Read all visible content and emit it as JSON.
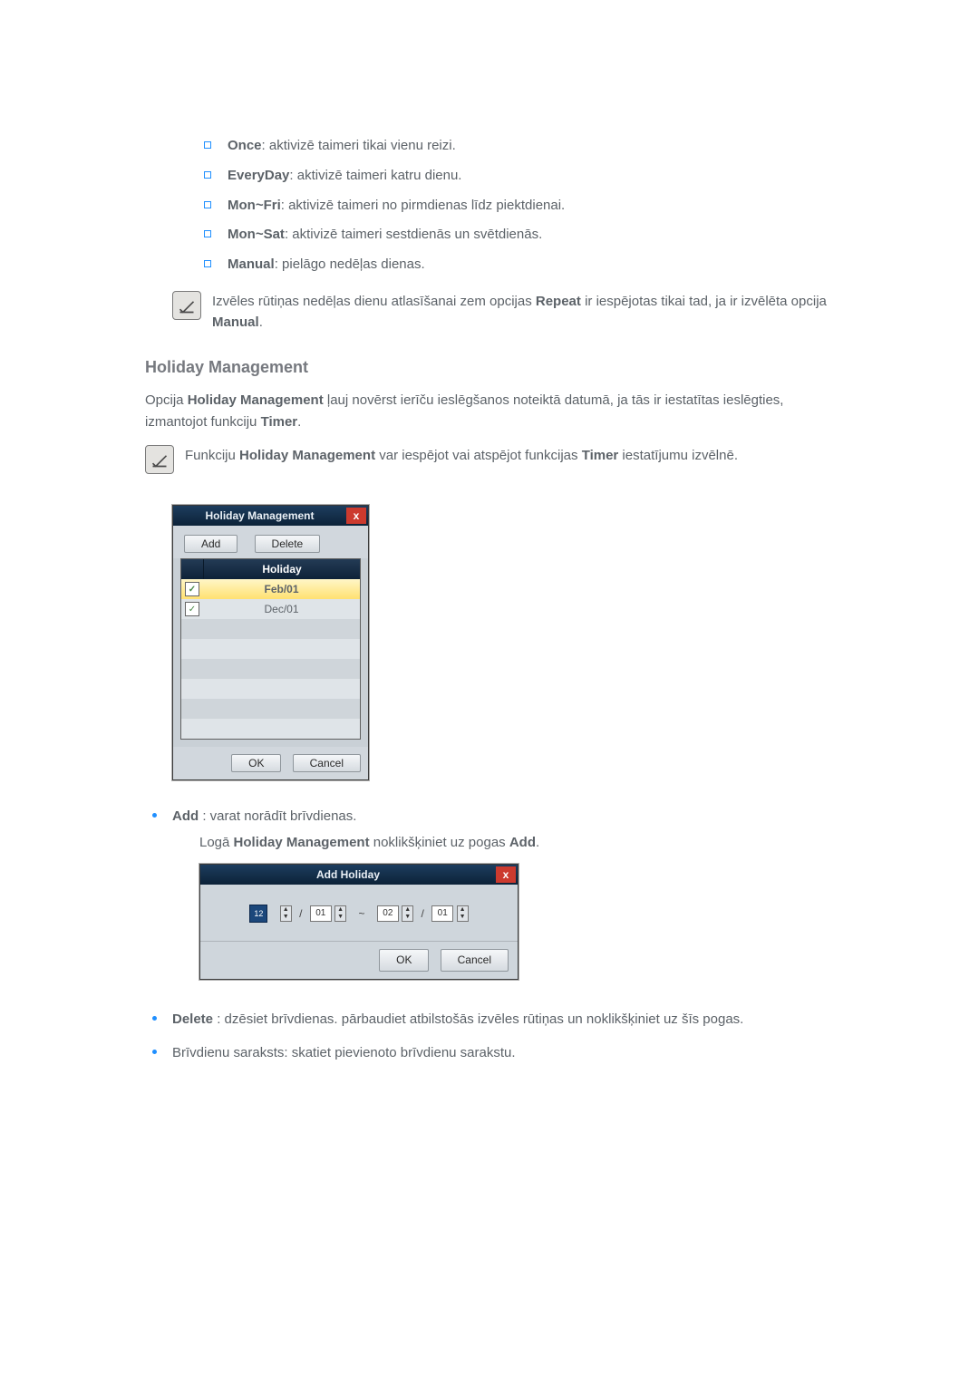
{
  "sublist": [
    {
      "label": "Once",
      "desc": ": aktivizē taimeri tikai vienu reizi."
    },
    {
      "label": "EveryDay",
      "desc": ": aktivizē taimeri katru dienu."
    },
    {
      "label": "Mon~Fri",
      "desc": ": aktivizē taimeri no pirmdienas līdz piektdienai."
    },
    {
      "label": "Mon~Sat",
      "desc": ": aktivizē taimeri sestdienās un svētdienās."
    },
    {
      "label": "Manual",
      "desc": ": pielāgo nedēļas dienas."
    }
  ],
  "note1": {
    "pre": "Izvēles rūtiņas nedēļas dienu atlasīšanai zem opcijas ",
    "b1": "Repeat",
    "mid": " ir iespējotas tikai tad, ja ir izvēlēta opcija ",
    "b2": "Manual",
    "post": "."
  },
  "section_heading": "Holiday Management",
  "para1": {
    "pre": "Opcija ",
    "b1": "Holiday Management",
    "mid": " ļauj novērst ierīču ieslēgšanos noteiktā datumā, ja tās ir iestatītas ieslēgties, izmantojot funkciju ",
    "b2": "Timer",
    "post": "."
  },
  "note2": {
    "pre": "Funkciju ",
    "b1": "Holiday Management",
    "mid": " var iespējot vai atspējot funkcijas ",
    "b2": "Timer",
    "post": " iestatījumu izvēlnē."
  },
  "hm_window": {
    "title": "Holiday Management",
    "add": "Add",
    "delete": "Delete",
    "col": "Holiday",
    "rows": [
      "Feb/01",
      "Dec/01"
    ],
    "ok": "OK",
    "cancel": "Cancel"
  },
  "bullets": {
    "add": {
      "b": "Add",
      "rest": " : varat norādīt brīvdienas."
    },
    "add_sub": {
      "pre": "Logā ",
      "b1": "Holiday Management",
      "mid": " noklikšķiniet uz pogas ",
      "b2": "Add",
      "post": "."
    },
    "delete": {
      "b": "Delete",
      "rest": " : dzēsiet brīvdienas. pārbaudiet atbilstošās izvēles rūtiņas un noklikšķiniet uz šīs pogas."
    },
    "list": "Brīvdienu saraksts: skatiet pievienoto brīvdienu sarakstu."
  },
  "add_window": {
    "title": "Add Holiday",
    "cal": "12",
    "m1": "01",
    "d1": "01",
    "m2": "02",
    "d2": "01",
    "ok": "OK",
    "cancel": "Cancel"
  }
}
